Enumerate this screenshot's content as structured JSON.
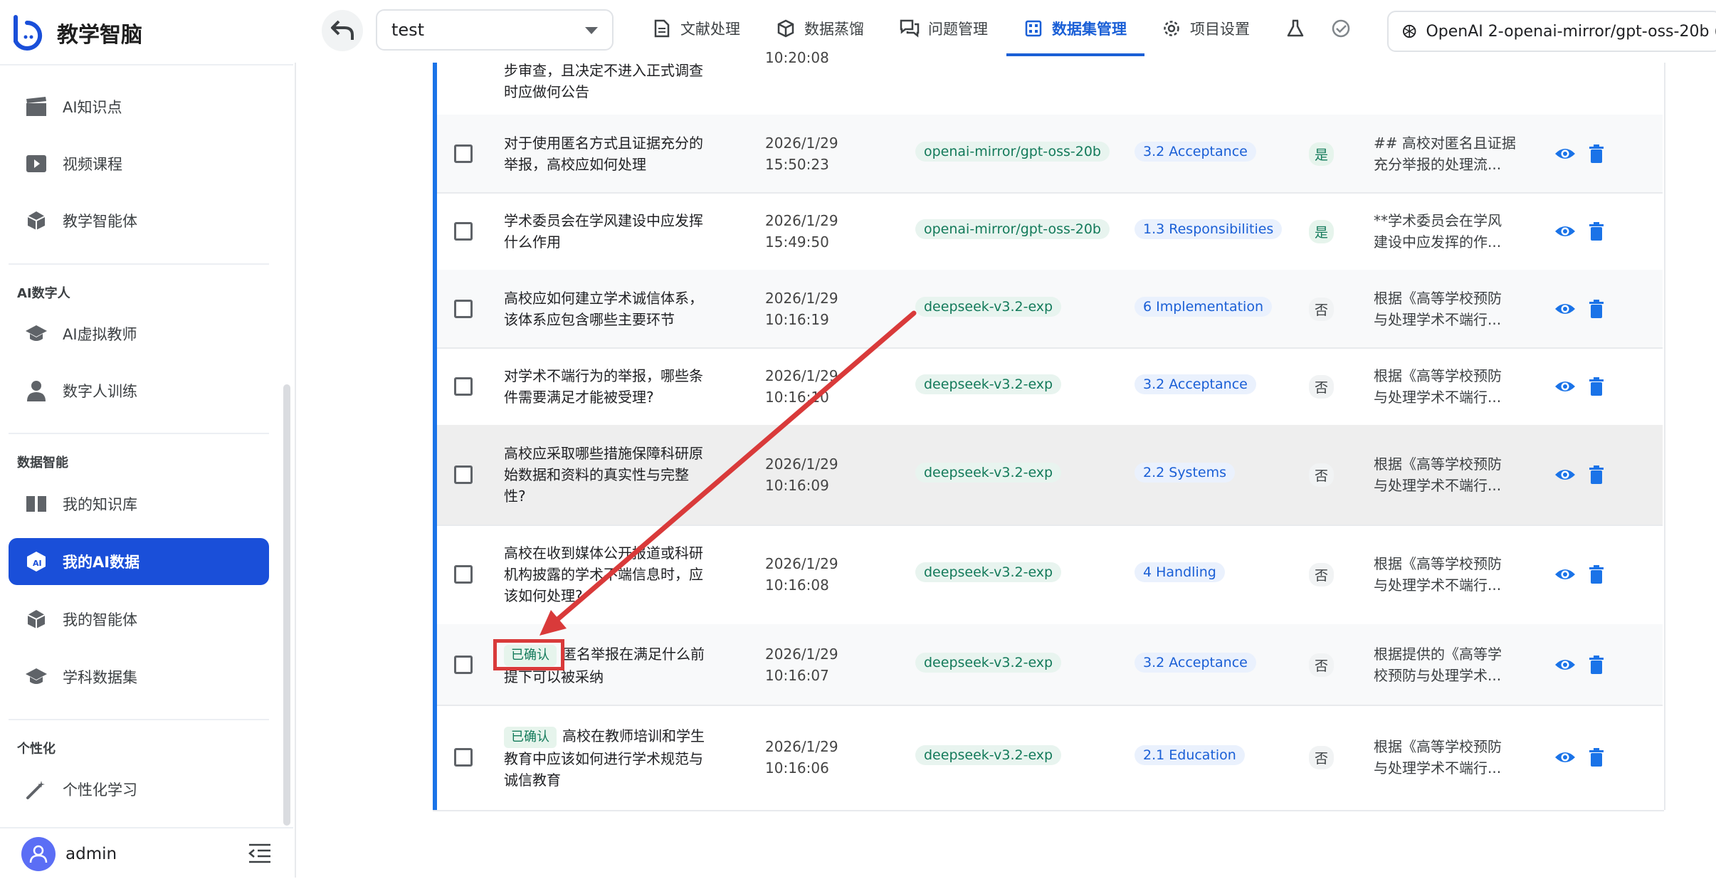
{
  "app": {
    "title": "教学智脑"
  },
  "sidebar": {
    "items_top": [
      {
        "label": "AI知识点",
        "icon": "clapperboard-icon"
      },
      {
        "label": "视频课程",
        "icon": "video-play-icon"
      },
      {
        "label": "教学智能体",
        "icon": "cube-icon"
      }
    ],
    "section_ai_human": "AI数字人",
    "items_ai_human": [
      {
        "label": "AI虚拟教师",
        "icon": "graduation-cap-icon"
      },
      {
        "label": "数字人训练",
        "icon": "person-icon"
      }
    ],
    "section_data": "数据智能",
    "items_data": [
      {
        "label": "我的知识库",
        "icon": "book-icon"
      },
      {
        "label": "我的AI数据",
        "icon": "ai-data-cube-icon",
        "active": true
      },
      {
        "label": "我的智能体",
        "icon": "cube-icon"
      },
      {
        "label": "学科数据集",
        "icon": "graduation-cap-icon"
      }
    ],
    "section_personal": "个性化",
    "items_personal": [
      {
        "label": "个性化学习",
        "icon": "magic-wand-icon"
      }
    ],
    "user": {
      "name": "admin"
    }
  },
  "topbar": {
    "project": "test",
    "tabs": [
      {
        "label": "文献处理",
        "icon": "document-icon"
      },
      {
        "label": "数据蒸馏",
        "icon": "cube-outline-icon"
      },
      {
        "label": "问题管理",
        "icon": "chat-icon"
      },
      {
        "label": "数据集管理",
        "icon": "grid-icon",
        "active": true
      },
      {
        "label": "项目设置",
        "icon": "gear-icon"
      }
    ],
    "model": "OpenAI 2-openai-mirror/gpt-oss-20b ("
  },
  "table": {
    "rows": [
      {
        "q_lines": [
          "步审查，且决定不进入正式调查",
          "时应做何公告"
        ],
        "time": [
          "",
          "10:20:08"
        ],
        "partial": true
      },
      {
        "q_lines": [
          "对于使用匿名方式且证据充分的",
          "举报，高校应如何处理"
        ],
        "time": [
          "2026/1/29",
          "15:50:23"
        ],
        "model": "openai-mirror/gpt-oss-20b",
        "tag": "3.2 Acceptance",
        "yn": "是",
        "answer": [
          "## 高校对匿名且证据",
          "充分举报的处理流..."
        ]
      },
      {
        "q_lines": [
          "学术委员会在学风建设中应发挥",
          "什么作用"
        ],
        "time": [
          "2026/1/29",
          "15:49:50"
        ],
        "model": "openai-mirror/gpt-oss-20b",
        "tag": "1.3 Responsibilities",
        "yn": "是",
        "answer": [
          "**学术委员会在学风",
          "建设中应发挥的作..."
        ]
      },
      {
        "q_lines": [
          "高校应如何建立学术诚信体系，",
          "该体系应包含哪些主要环节"
        ],
        "time": [
          "2026/1/29",
          "10:16:19"
        ],
        "model": "deepseek-v3.2-exp",
        "tag": "6 Implementation",
        "yn": "否",
        "answer": [
          "根据《高等学校预防",
          "与处理学术不端行..."
        ]
      },
      {
        "q_lines": [
          "对学术不端行为的举报，哪些条",
          "件需要满足才能被受理?"
        ],
        "time": [
          "2026/1/29",
          "10:16:10"
        ],
        "model": "deepseek-v3.2-exp",
        "tag": "3.2 Acceptance",
        "yn": "否",
        "answer": [
          "根据《高等学校预防",
          "与处理学术不端行..."
        ]
      },
      {
        "q_lines": [
          "高校应采取哪些措施保障科研原",
          "始数据和资料的真实性与完整",
          "性?"
        ],
        "time": [
          "2026/1/29",
          "10:16:09"
        ],
        "model": "deepseek-v3.2-exp",
        "tag": "2.2 Systems",
        "yn": "否",
        "answer": [
          "根据《高等学校预防",
          "与处理学术不端行..."
        ]
      },
      {
        "q_lines": [
          "高校在收到媒体公开报道或科研",
          "机构披露的学术不端信息时，应",
          "该如何处理?"
        ],
        "time": [
          "2026/1/29",
          "10:16:08"
        ],
        "model": "deepseek-v3.2-exp",
        "tag": "4 Handling",
        "yn": "否",
        "answer": [
          "根据《高等学校预防",
          "与处理学术不端行..."
        ]
      },
      {
        "badge": "已确认",
        "q_lines": [
          "匿名举报在满足什么前",
          "提下可以被采纳"
        ],
        "time": [
          "2026/1/29",
          "10:16:07"
        ],
        "model": "deepseek-v3.2-exp",
        "tag": "3.2 Acceptance",
        "yn": "否",
        "answer": [
          "根据提供的《高等学",
          "校预防与处理学术..."
        ]
      },
      {
        "badge": "已确认",
        "q_lines": [
          "高校在教师培训和学生",
          "教育中应该如何进行学术规范与",
          "诚信教育"
        ],
        "time": [
          "2026/1/29",
          "10:16:06"
        ],
        "model": "deepseek-v3.2-exp",
        "tag": "2.1 Education",
        "yn": "否",
        "answer": [
          "根据《高等学校预防",
          "与处理学术不端行..."
        ]
      }
    ]
  },
  "colors": {
    "accent": "#1a4fd9",
    "annotation": "#d93a3a"
  }
}
